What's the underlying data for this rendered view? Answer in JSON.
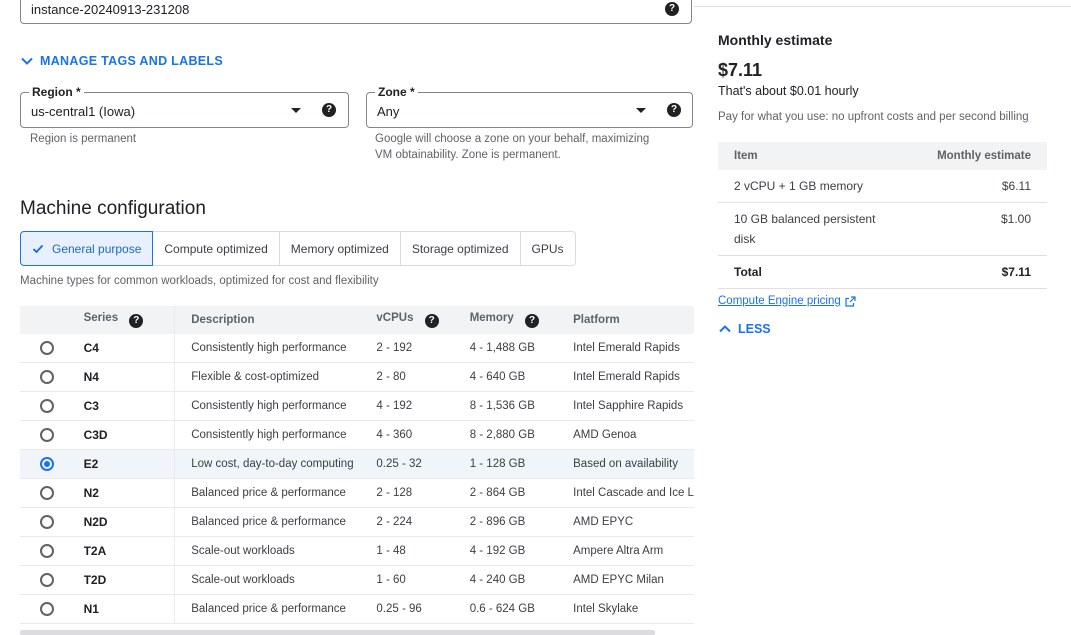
{
  "instance_name": {
    "value": "instance-20240913-231208"
  },
  "manage_tags": {
    "label": "MANAGE TAGS AND LABELS"
  },
  "region": {
    "label": "Region *",
    "value": "us-central1 (Iowa)",
    "hint": "Region is permanent"
  },
  "zone": {
    "label": "Zone *",
    "value": "Any",
    "hint_line1": "Google will choose a zone on your behalf, maximizing",
    "hint_line2": "VM obtainability. Zone is permanent."
  },
  "machine_config": {
    "title": "Machine configuration",
    "tabs": [
      "General purpose",
      "Compute optimized",
      "Memory optimized",
      "Storage optimized",
      "GPUs"
    ],
    "description": "Machine types for common workloads, optimized for cost and flexibility",
    "columns": {
      "series": "Series",
      "description": "Description",
      "vcpus": "vCPUs",
      "memory": "Memory",
      "platform": "Platform"
    },
    "rows": [
      {
        "series": "C4",
        "description": "Consistently high performance",
        "vcpus": "2 - 192",
        "memory": "4 - 1,488 GB",
        "platform": "Intel Emerald Rapids",
        "selected": false
      },
      {
        "series": "N4",
        "description": "Flexible & cost-optimized",
        "vcpus": "2 - 80",
        "memory": "4 - 640 GB",
        "platform": "Intel Emerald Rapids",
        "selected": false
      },
      {
        "series": "C3",
        "description": "Consistently high performance",
        "vcpus": "4 - 192",
        "memory": "8 - 1,536 GB",
        "platform": "Intel Sapphire Rapids",
        "selected": false
      },
      {
        "series": "C3D",
        "description": "Consistently high performance",
        "vcpus": "4 - 360",
        "memory": "8 - 2,880 GB",
        "platform": "AMD Genoa",
        "selected": false
      },
      {
        "series": "E2",
        "description": "Low cost, day-to-day computing",
        "vcpus": "0.25 - 32",
        "memory": "1 - 128 GB",
        "platform": "Based on availability",
        "selected": true
      },
      {
        "series": "N2",
        "description": "Balanced price & performance",
        "vcpus": "2 - 128",
        "memory": "2 - 864 GB",
        "platform": "Intel Cascade and Ice L",
        "selected": false
      },
      {
        "series": "N2D",
        "description": "Balanced price & performance",
        "vcpus": "2 - 224",
        "memory": "2 - 896 GB",
        "platform": "AMD EPYC",
        "selected": false
      },
      {
        "series": "T2A",
        "description": "Scale-out workloads",
        "vcpus": "1 - 48",
        "memory": "4 - 192 GB",
        "platform": "Ampere Altra Arm",
        "selected": false
      },
      {
        "series": "T2D",
        "description": "Scale-out workloads",
        "vcpus": "1 - 60",
        "memory": "4 - 240 GB",
        "platform": "AMD EPYC Milan",
        "selected": false
      },
      {
        "series": "N1",
        "description": "Balanced price & performance",
        "vcpus": "0.25 - 96",
        "memory": "0.6 - 624 GB",
        "platform": "Intel Skylake",
        "selected": false
      }
    ]
  },
  "estimate": {
    "title": "Monthly estimate",
    "price": "$7.11",
    "hourly": "That's about $0.01 hourly",
    "note": "Pay for what you use: no upfront costs and per second billing",
    "header_item": "Item",
    "header_cost": "Monthly estimate",
    "items": [
      {
        "item": "2 vCPU + 1 GB memory",
        "cost": "$6.11"
      },
      {
        "item_line1": "10 GB balanced persistent",
        "item_line2": "disk",
        "cost": "$1.00"
      }
    ],
    "total_label": "Total",
    "total_value": "$7.11",
    "pricing_link": "Compute Engine pricing",
    "less_label": "LESS"
  },
  "icons": {
    "help": "?",
    "accent": "#1a73e8"
  }
}
